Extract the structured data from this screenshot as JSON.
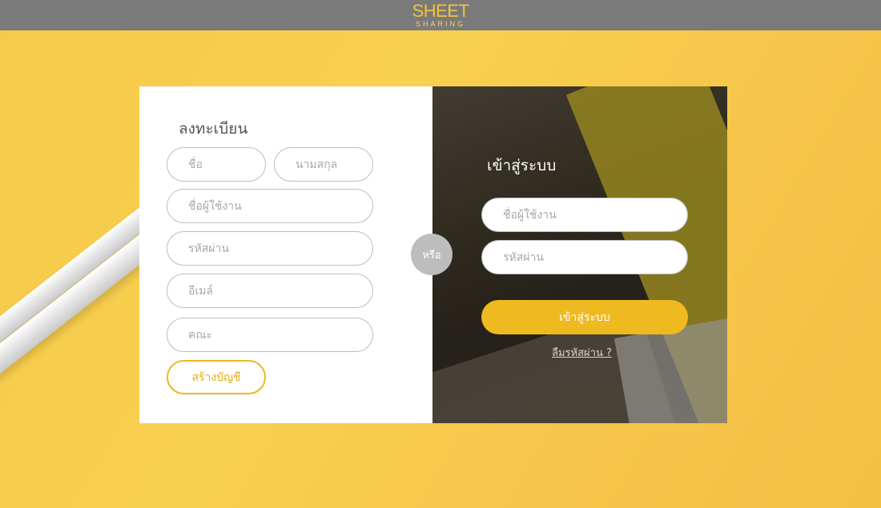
{
  "header": {
    "logo_top": "SHEET",
    "logo_bottom": "SHARING"
  },
  "register": {
    "title": "ลงทะเบียน",
    "first_name_placeholder": "ชื่อ",
    "last_name_placeholder": "นามสกุล",
    "username_placeholder": "ชื่อผู้ใช้งาน",
    "password_placeholder": "รหัสผ่าน",
    "email_placeholder": "อีเมล์",
    "faculty_placeholder": "คณะ",
    "create_button_label": "สร้างบัญชี"
  },
  "divider": {
    "or_label": "หรือ"
  },
  "login": {
    "title": "เข้าสู่ระบบ",
    "username_placeholder": "ชื่อผู้ใช้งาน",
    "password_placeholder": "รหัสผ่าน",
    "login_button_label": "เข้าสู่ระบบ",
    "forgot_link_label": "ลืมรหัสผ่าน ?"
  },
  "colors": {
    "background": "#f6c94a",
    "header": "#7a7a7a",
    "accent": "#efb920",
    "divider_badge": "#bdbdbd"
  }
}
